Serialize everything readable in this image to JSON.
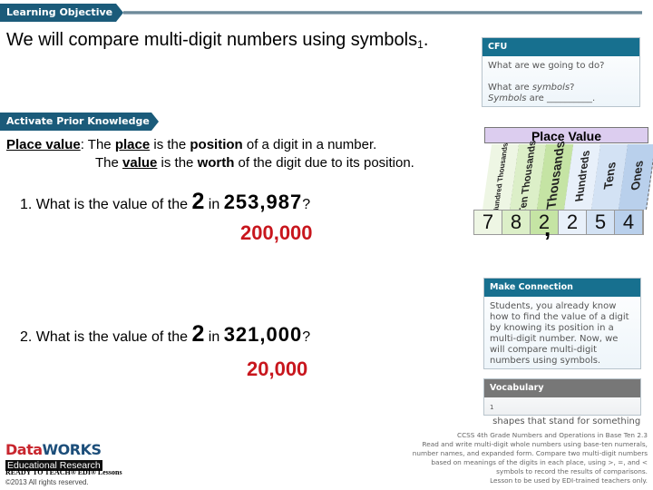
{
  "learning_objective": {
    "banner": "Learning Objective",
    "text": "We will compare multi-digit numbers using symbols",
    "footnote_mark": "1",
    "period": "."
  },
  "cfu": {
    "title": "CFU",
    "q1": "What are we going to do?",
    "q2_pre": "What are ",
    "q2_em": "symbols",
    "q2_post": "?",
    "q3_em": "Symbols",
    "q3_post": " are __________."
  },
  "activate_prior_knowledge": {
    "banner": "Activate Prior Knowledge",
    "term": "Place value",
    "colon": ":",
    "line1": {
      "a": " The ",
      "u": "place",
      "b": " is the ",
      "bold": "position",
      "c": " of a digit in a number."
    },
    "line2": {
      "a": "The ",
      "u": "value",
      "b": " is the ",
      "bold": "worth",
      "c": " of the digit due to its position."
    }
  },
  "place_value_chart": {
    "title": "Place Value",
    "columns": [
      {
        "label": "Hundred Thousands",
        "digit": "7",
        "color": "#eef6e4"
      },
      {
        "label": "Ten Thousands",
        "digit": "8",
        "color": "#dcefc8"
      },
      {
        "label": "Thousands",
        "digit": "2",
        "color": "#c5e4a4"
      },
      {
        "label": "Hundreds",
        "digit": "2",
        "color": "#e8f0fa"
      },
      {
        "label": "Tens",
        "digit": "5",
        "color": "#d3e2f4"
      },
      {
        "label": "Ones",
        "digit": "4",
        "color": "#b9d0ec"
      }
    ],
    "comma": ","
  },
  "questions": [
    {
      "prefix": "1. What is the value of the ",
      "digit": "2",
      "mid": " in ",
      "number": "253,987",
      "suffix": "?",
      "answer": "200,000"
    },
    {
      "prefix": "2. What is the value of the ",
      "digit": "2",
      "mid": " in ",
      "number": "321,000",
      "suffix": "?",
      "answer": "20,000"
    }
  ],
  "make_connection": {
    "title": "Make Connection",
    "text": "Students, you already know how to find the value of a digit by knowing its position in a multi-digit number. Now, we will compare multi-digit numbers using symbols."
  },
  "vocabulary": {
    "title": "Vocabulary",
    "mark": "1",
    "text": " shapes that stand for something"
  },
  "standards": {
    "line1": "CCSS 4th Grade Numbers and Operations in Base Ten 2.3",
    "line2": "Read and write multi-digit whole numbers using base-ten numerals,",
    "line3": "number names, and expanded form. Compare two multi-digit numbers",
    "line4": "based on meanings of the digits in each place, using >, =, and <",
    "line5": "symbols to record the results of comparisons.",
    "line6": "Lesson to be used by EDI-trained teachers only."
  },
  "footer": {
    "logo_data": "Data",
    "logo_works": "WORKS",
    "logo_sub": "Educational Research",
    "ready": "READY TO TEACH® EDI® Lessons",
    "copyright": "©2013 All rights reserved."
  },
  "colors": {
    "banner": "#1b5b7a",
    "card_header": "#17708f",
    "answer": "#c8161d",
    "vocab_header": "#777777"
  }
}
